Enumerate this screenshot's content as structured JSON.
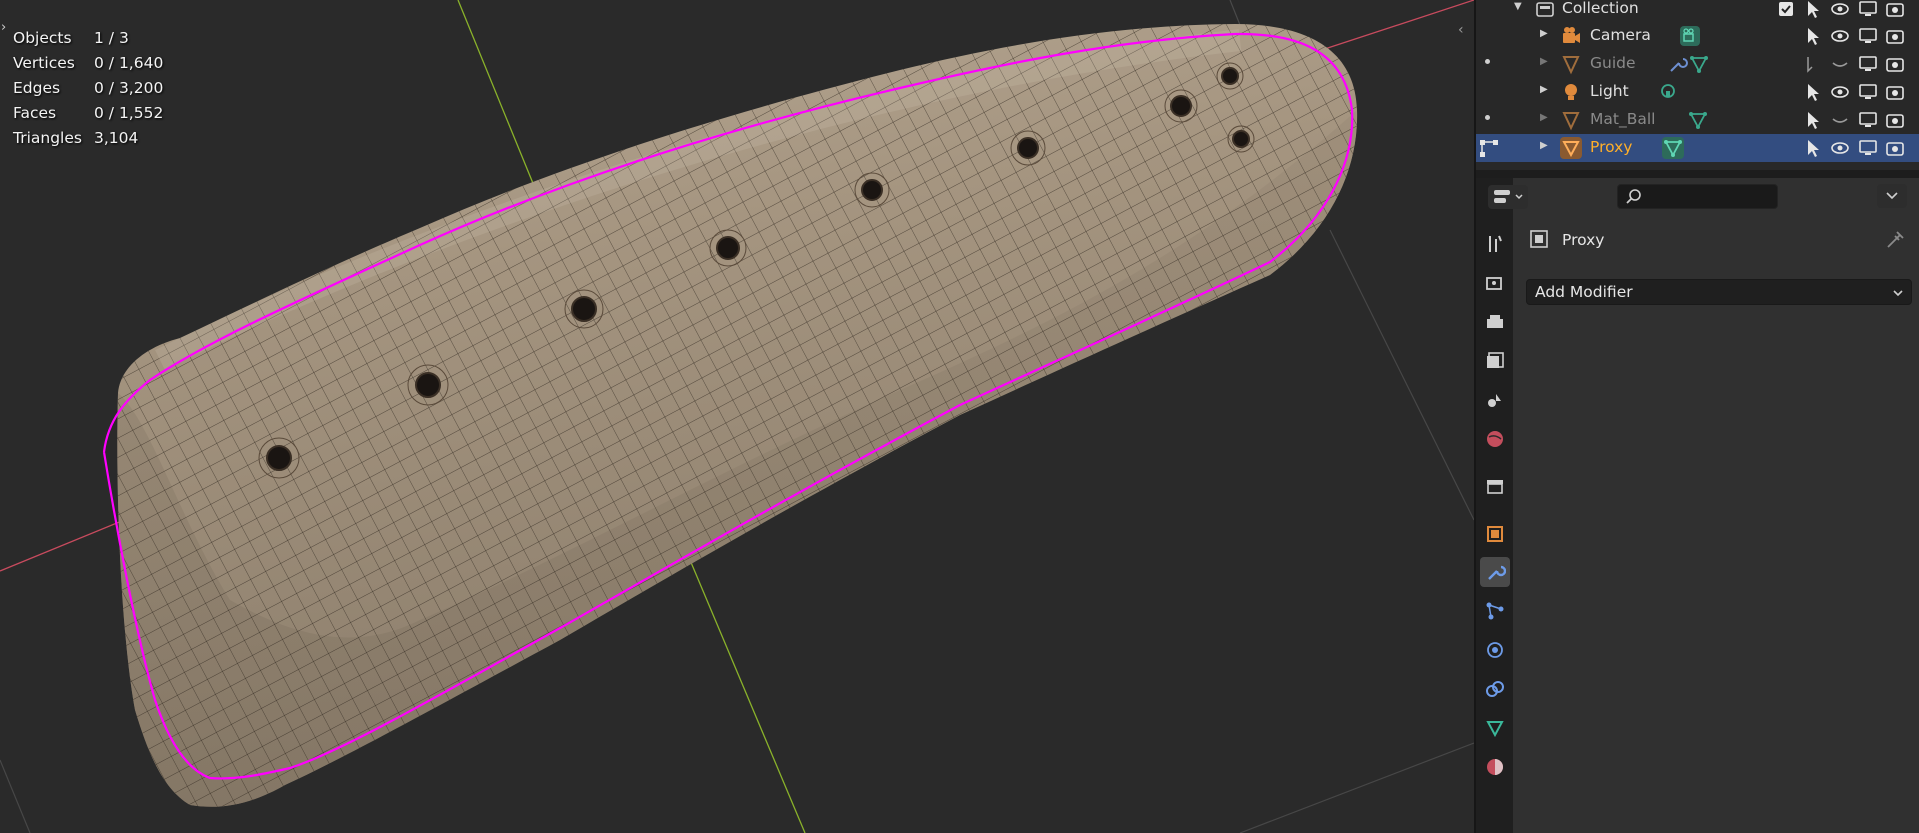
{
  "colors": {
    "selection_outline": "#ff00ff",
    "x_axis": "#c84b5e",
    "y_axis": "#8ab22a",
    "selected_row": "#334d80",
    "active_object_text": "#ffaf29",
    "mesh_surface": "#a39480"
  },
  "viewport": {
    "stats": [
      {
        "label": "Objects",
        "value": "1 / 3"
      },
      {
        "label": "Vertices",
        "value": "0 / 1,640"
      },
      {
        "label": "Edges",
        "value": "0 / 3,200"
      },
      {
        "label": "Faces",
        "value": "0 / 1,552"
      },
      {
        "label": "Triangles",
        "value": "3,104"
      }
    ]
  },
  "outliner": {
    "collection": {
      "name": "Collection",
      "icon": "collection-icon",
      "checked": true
    },
    "items": [
      {
        "name": "Camera",
        "icon": "camera-object-icon",
        "data_icon": "camera-data-icon",
        "hidden": false,
        "selected": false
      },
      {
        "name": "Guide",
        "icon": "mesh-object-icon",
        "data_icon": "modifier-wrench-icon",
        "hidden": true,
        "selected": false
      },
      {
        "name": "Light",
        "icon": "light-object-icon",
        "data_icon": "light-data-icon",
        "hidden": false,
        "selected": false
      },
      {
        "name": "Mat_Ball",
        "icon": "mesh-object-icon",
        "data_icon": "mesh-data-icon",
        "hidden": true,
        "selected": false
      },
      {
        "name": "Proxy",
        "icon": "mesh-object-icon",
        "data_icon": "mesh-data-icon",
        "hidden": false,
        "selected": true
      }
    ]
  },
  "properties": {
    "search_placeholder": "",
    "object_name": "Proxy",
    "add_modifier_label": "Add Modifier",
    "tabs": [
      "tool-icon",
      "render-icon",
      "output-icon",
      "view-layer-icon",
      "scene-icon",
      "world-icon",
      "collection-icon",
      "object-icon",
      "modifier-icon",
      "particles-icon",
      "physics-icon",
      "constraints-icon",
      "data-icon",
      "material-icon"
    ],
    "active_tab": "modifier-icon"
  }
}
